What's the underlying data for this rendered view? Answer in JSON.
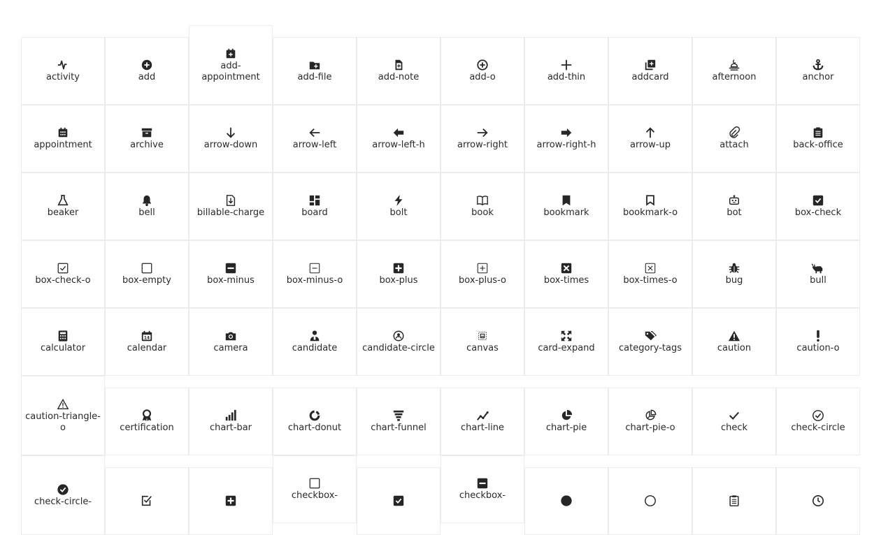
{
  "icons": [
    {
      "label": "activity",
      "icon": "activity-icon"
    },
    {
      "label": "add",
      "icon": "add-icon"
    },
    {
      "label": "add-appointment",
      "icon": "add-appointment-icon"
    },
    {
      "label": "add-file",
      "icon": "add-file-icon"
    },
    {
      "label": "add-note",
      "icon": "add-note-icon"
    },
    {
      "label": "add-o",
      "icon": "add-o-icon"
    },
    {
      "label": "add-thin",
      "icon": "add-thin-icon"
    },
    {
      "label": "addcard",
      "icon": "addcard-icon"
    },
    {
      "label": "afternoon",
      "icon": "afternoon-icon"
    },
    {
      "label": "anchor",
      "icon": "anchor-icon"
    },
    {
      "label": "appointment",
      "icon": "appointment-icon"
    },
    {
      "label": "archive",
      "icon": "archive-icon"
    },
    {
      "label": "arrow-down",
      "icon": "arrow-down-icon"
    },
    {
      "label": "arrow-left",
      "icon": "arrow-left-icon"
    },
    {
      "label": "arrow-left-h",
      "icon": "arrow-left-h-icon"
    },
    {
      "label": "arrow-right",
      "icon": "arrow-right-icon"
    },
    {
      "label": "arrow-right-h",
      "icon": "arrow-right-h-icon"
    },
    {
      "label": "arrow-up",
      "icon": "arrow-up-icon"
    },
    {
      "label": "attach",
      "icon": "attach-icon"
    },
    {
      "label": "back-office",
      "icon": "back-office-icon"
    },
    {
      "label": "beaker",
      "icon": "beaker-icon"
    },
    {
      "label": "bell",
      "icon": "bell-icon"
    },
    {
      "label": "billable-charge",
      "icon": "billable-charge-icon"
    },
    {
      "label": "board",
      "icon": "board-icon"
    },
    {
      "label": "bolt",
      "icon": "bolt-icon"
    },
    {
      "label": "book",
      "icon": "book-icon"
    },
    {
      "label": "bookmark",
      "icon": "bookmark-icon"
    },
    {
      "label": "bookmark-o",
      "icon": "bookmark-o-icon"
    },
    {
      "label": "bot",
      "icon": "bot-icon"
    },
    {
      "label": "box-check",
      "icon": "box-check-icon"
    },
    {
      "label": "box-check-o",
      "icon": "box-check-o-icon"
    },
    {
      "label": "box-empty",
      "icon": "box-empty-icon"
    },
    {
      "label": "box-minus",
      "icon": "box-minus-icon"
    },
    {
      "label": "box-minus-o",
      "icon": "box-minus-o-icon"
    },
    {
      "label": "box-plus",
      "icon": "box-plus-icon"
    },
    {
      "label": "box-plus-o",
      "icon": "box-plus-o-icon"
    },
    {
      "label": "box-times",
      "icon": "box-times-icon"
    },
    {
      "label": "box-times-o",
      "icon": "box-times-o-icon"
    },
    {
      "label": "bug",
      "icon": "bug-icon"
    },
    {
      "label": "bull",
      "icon": "bull-icon"
    },
    {
      "label": "calculator",
      "icon": "calculator-icon"
    },
    {
      "label": "calendar",
      "icon": "calendar-icon"
    },
    {
      "label": "camera",
      "icon": "camera-icon"
    },
    {
      "label": "candidate",
      "icon": "candidate-icon"
    },
    {
      "label": "candidate-circle",
      "icon": "candidate-circle-icon"
    },
    {
      "label": "canvas",
      "icon": "canvas-icon"
    },
    {
      "label": "card-expand",
      "icon": "card-expand-icon"
    },
    {
      "label": "category-tags",
      "icon": "category-tags-icon"
    },
    {
      "label": "caution",
      "icon": "caution-icon"
    },
    {
      "label": "caution-o",
      "icon": "caution-o-icon"
    },
    {
      "label": "caution-triangle-o",
      "icon": "caution-triangle-o-icon"
    },
    {
      "label": "certification",
      "icon": "certification-icon"
    },
    {
      "label": "chart-bar",
      "icon": "chart-bar-icon"
    },
    {
      "label": "chart-donut",
      "icon": "chart-donut-icon"
    },
    {
      "label": "chart-funnel",
      "icon": "chart-funnel-icon"
    },
    {
      "label": "chart-line",
      "icon": "chart-line-icon"
    },
    {
      "label": "chart-pie",
      "icon": "chart-pie-icon"
    },
    {
      "label": "chart-pie-o",
      "icon": "chart-pie-o-icon"
    },
    {
      "label": "check",
      "icon": "check-icon"
    },
    {
      "label": "check-circle",
      "icon": "check-circle-icon"
    },
    {
      "label": "check-circle-",
      "icon": "check-circle-filled-icon"
    },
    {
      "label": "",
      "icon": "checkbox-check-icon"
    },
    {
      "label": "",
      "icon": "checkbox-plus-icon"
    },
    {
      "label": "checkbox-",
      "icon": "checkbox-empty-icon"
    },
    {
      "label": "",
      "icon": "checkbox-checked-icon"
    },
    {
      "label": "checkbox-",
      "icon": "checkbox-minus-icon"
    },
    {
      "label": "",
      "icon": "circle-icon"
    },
    {
      "label": "",
      "icon": "circle-o-icon"
    },
    {
      "label": "",
      "icon": "clipboard-icon"
    },
    {
      "label": "",
      "icon": "clock-icon"
    }
  ]
}
